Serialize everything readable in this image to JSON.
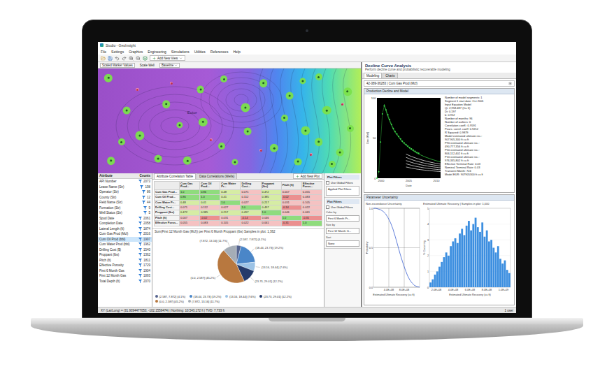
{
  "window": {
    "title": "Studio - GeoInsight"
  },
  "menu": [
    "File",
    "Settings",
    "Graphics",
    "Engineering",
    "Simulations",
    "Utilities",
    "References",
    "Help"
  ],
  "toolbar": {
    "add_view": "Add New View"
  },
  "map": {
    "toolbar": [
      {
        "label": "Scaled Marker Values",
        "kind": "field"
      },
      {
        "label": "Scale Well",
        "kind": "label"
      },
      {
        "label": "Baseline",
        "kind": "select"
      }
    ],
    "label": "Ector",
    "wells": [
      {
        "x": 4,
        "y": 9,
        "level": 0.8,
        "kind": "producer",
        "color": "#7be24c"
      },
      {
        "x": 11,
        "y": 40,
        "level": 0.6,
        "kind": "producer",
        "color": "#7be24c"
      },
      {
        "x": 16,
        "y": 64,
        "level": 0.9,
        "kind": "producer",
        "color": "#7be24c"
      },
      {
        "x": 9,
        "y": 70,
        "level": 0.5,
        "kind": "producer",
        "color": "#7be24c"
      },
      {
        "x": 26,
        "y": 34,
        "level": 0.7,
        "kind": "producer",
        "color": "#7be24c"
      },
      {
        "x": 31,
        "y": 54,
        "level": 0.4,
        "kind": "producer",
        "color": "#7be24c"
      },
      {
        "x": 39,
        "y": 20,
        "level": 0.6,
        "kind": "producer",
        "color": "#7be24c"
      },
      {
        "x": 40,
        "y": 51,
        "level": 0.8,
        "kind": "producer",
        "color": "#7be24c"
      },
      {
        "x": 47,
        "y": 74,
        "level": 0.5,
        "kind": "producer",
        "color": "#7be24c"
      },
      {
        "x": 56,
        "y": 37,
        "level": 0.9,
        "kind": "producer",
        "color": "#7be24c"
      },
      {
        "x": 57,
        "y": 60,
        "level": 0.6,
        "kind": "producer",
        "color": "#7be24c"
      },
      {
        "x": 63,
        "y": 14,
        "level": 0.7,
        "kind": "producer",
        "color": "#7be24c"
      },
      {
        "x": 67,
        "y": 76,
        "level": 0.8,
        "kind": "producer",
        "color": "#7be24c"
      },
      {
        "x": 71,
        "y": 47,
        "level": 0.5,
        "kind": "producer",
        "color": "#7be24c"
      },
      {
        "x": 73,
        "y": 26,
        "level": 0.6,
        "kind": "producer",
        "color": "#7be24c"
      },
      {
        "x": 78,
        "y": 12,
        "level": 0.4,
        "kind": "producer",
        "color": "#7be24c"
      },
      {
        "x": 79,
        "y": 59,
        "level": 0.9,
        "kind": "producer",
        "color": "#7be24c"
      },
      {
        "x": 84,
        "y": 8,
        "level": 0.5,
        "kind": "producer",
        "color": "#7be24c"
      },
      {
        "x": 84,
        "y": 70,
        "level": 0.7,
        "kind": "producer",
        "color": "#7be24c"
      },
      {
        "x": 87,
        "y": 40,
        "level": 0.8,
        "kind": "producer",
        "color": "#7be24c"
      },
      {
        "x": 92,
        "y": 80,
        "level": 0.6,
        "kind": "producer",
        "color": "#7be24c"
      },
      {
        "x": 95,
        "y": 22,
        "level": 0.7,
        "kind": "producer",
        "color": "#7be24c"
      },
      {
        "x": 96,
        "y": 57,
        "level": 0.5,
        "kind": "producer",
        "color": "#7be24c"
      },
      {
        "x": 23,
        "y": 86,
        "level": 0.6,
        "kind": "producer",
        "color": "#7be24c"
      },
      {
        "x": 34,
        "y": 88,
        "level": 0.8,
        "kind": "producer",
        "color": "#7be24c"
      },
      {
        "x": 48,
        "y": 10,
        "level": 0.5,
        "kind": "producer",
        "color": "#7be24c"
      },
      {
        "x": 5,
        "y": 88,
        "level": 0.7,
        "kind": "producer",
        "color": "#7be24c"
      },
      {
        "x": 52,
        "y": 89,
        "level": 0.4,
        "kind": "producer",
        "color": "#7be24c"
      },
      {
        "x": 76,
        "y": 89,
        "level": 0.6,
        "kind": "producer",
        "color": "#7be24c"
      },
      {
        "x": 89,
        "y": 91,
        "level": 0.5,
        "kind": "producer",
        "color": "#7be24c"
      },
      {
        "x": 15,
        "y": 20,
        "level": 0.3,
        "kind": "dry",
        "color": "#f08fb0"
      },
      {
        "x": 28,
        "y": 14,
        "level": 0.3,
        "kind": "dry",
        "color": "#f08fb0"
      },
      {
        "x": 43,
        "y": 68,
        "level": 0.3,
        "kind": "dry",
        "color": "#f08fb0"
      },
      {
        "x": 62,
        "y": 78,
        "level": 0.3,
        "kind": "dry",
        "color": "#f08fb0"
      },
      {
        "x": 81,
        "y": 82,
        "level": 0.3,
        "kind": "dry",
        "color": "#f08fb0"
      },
      {
        "x": 93,
        "y": 34,
        "level": 0.3,
        "kind": "dry",
        "color": "#f08fb0"
      }
    ]
  },
  "attributes": {
    "header": [
      "Attribute",
      "Counts"
    ],
    "items": [
      {
        "name": "API Number",
        "count": "2073",
        "selected": false
      },
      {
        "name": "Lease Name (Str)",
        "count": "198",
        "selected": false
      },
      {
        "name": "Operator (Str)",
        "count": "86",
        "selected": false
      },
      {
        "name": "County (Str)",
        "count": "12",
        "selected": false
      },
      {
        "name": "Field Name (Str)",
        "count": "44",
        "selected": false
      },
      {
        "name": "Formation (Str)",
        "count": "9",
        "selected": false
      },
      {
        "name": "Well Status (Str)",
        "count": "5",
        "selected": false
      },
      {
        "name": "Spud Date",
        "count": "2061",
        "selected": false
      },
      {
        "name": "Completion Date",
        "count": "2058",
        "selected": false
      },
      {
        "name": "Lateral Length (ft)",
        "count": "1874",
        "selected": false
      },
      {
        "name": "Cum Gas Prod (Mcf)",
        "count": "2016",
        "selected": false
      },
      {
        "name": "Cum Oil Prod (bbl)",
        "count": "1997",
        "selected": true
      },
      {
        "name": "Cum Water Prod (bbl)",
        "count": "1962",
        "selected": false
      },
      {
        "name": "Drilling Cost ($)",
        "count": "1540",
        "selected": false
      },
      {
        "name": "Proppant (lbs)",
        "count": "1362",
        "selected": false
      },
      {
        "name": "Pitch (ft)",
        "count": "1811",
        "selected": false
      },
      {
        "name": "Effective Porosity",
        "count": "1729",
        "selected": false
      },
      {
        "name": "First 6 Month Gas",
        "count": "1904",
        "selected": false
      },
      {
        "name": "First 12 Month Gas",
        "count": "1893",
        "selected": false
      },
      {
        "name": "Total Depth (ft)",
        "count": "2070",
        "selected": false
      }
    ]
  },
  "correlation": {
    "tabs": [
      {
        "label": "Attribute Correlation Table",
        "selected": true
      },
      {
        "label": "Data Correlations (Wells)",
        "selected": false
      }
    ],
    "add_plot": "Add New Plot",
    "columns": [
      "Cum Gas Prod...",
      "Cum Oil Prod...",
      "Cum Water Pr...",
      "Drilling Cost...",
      "Proppant (lbs)",
      "Pitch (ft)",
      "Effective Poros..."
    ],
    "rows": [
      {
        "name": "Cum Gas Prod...",
        "values": [
          "1.0",
          "0.86",
          "0.48",
          "0.071",
          "0.472",
          "0.007",
          "0.055"
        ]
      },
      {
        "name": "Cum Oil Prod...",
        "values": [
          "0.86",
          "1.0",
          "0.41",
          "0.112",
          "0.385",
          "-0.02",
          "0.083"
        ]
      },
      {
        "name": "Cum Water Pr...",
        "values": [
          "0.48",
          "0.41",
          "1.0",
          "0.027",
          "0.217",
          "0.031",
          "0.105"
        ]
      },
      {
        "name": "Drilling Cost...",
        "values": [
          "0.071",
          "0.112",
          "0.027",
          "1.0",
          "0.497",
          "-0.14",
          "0.022"
        ]
      },
      {
        "name": "Proppant (lbs)",
        "values": [
          "0.472",
          "0.385",
          "0.217",
          "0.497",
          "1.0",
          "0.046",
          "0.061"
        ]
      },
      {
        "name": "Pitch (ft)",
        "values": [
          "0.007",
          "-0.02",
          "0.031",
          "-0.14",
          "0.046",
          "1.0",
          "-0.31"
        ]
      },
      {
        "name": "Effective Poros...",
        "values": [
          "0.055",
          "0.083",
          "0.105",
          "0.022",
          "0.061",
          "-0.31",
          "1.0"
        ]
      }
    ]
  },
  "pie": {
    "title": "Sum(First 12 Month Gas (Mcf)) per First 6 Month Proppant (lbs)",
    "samples": "Samples in plot: 1,362",
    "slices": [
      {
        "label": "(2.587, 7.872] (4.1%)",
        "value": 4.1,
        "color": "#55648f"
      },
      {
        "label": "(18.44, 23.73] (19.2%)",
        "value": 19.2,
        "color": "#4a86c8"
      },
      {
        "label": "(13.16, 18.44] (7.6%)",
        "value": 7.6,
        "color": "#9cc3e6"
      },
      {
        "label": "(23.73, 29.01] (12.2%)",
        "value": 12.2,
        "color": "#243a6b"
      },
      {
        "label": "(0.0, 2.587] (45.2%)",
        "value": 45.2,
        "color": "#b8783f"
      },
      {
        "label": "(7.872, 13.16] (11.7%)",
        "value": 11.7,
        "color": "#a5adb6"
      }
    ]
  },
  "filters": {
    "top": {
      "title": "Plot Filters",
      "global": {
        "label": "Use Global Filters",
        "checked": false
      },
      "applied": "Applied Plot Filters"
    },
    "bottom": {
      "title": "Plot Filters",
      "global": {
        "label": "Use Global Filters",
        "checked": false
      },
      "fields": [
        {
          "label": "Color by",
          "value": "First 6 Month Pr..."
        },
        {
          "label": "Size by",
          "value": "First 12 Month G..."
        },
        {
          "label": "Sort",
          "value": "None"
        }
      ]
    }
  },
  "dca": {
    "title": "Decline Curve Analysis",
    "subtitle": "Perform decline curve and probabilistic recoverable modeling",
    "tabs": [
      {
        "label": "Modeling",
        "selected": true
      },
      {
        "label": "Charts",
        "selected": false
      }
    ],
    "well": "42-389-36283 | Cum Gas Prod (Mcf)",
    "chart": {
      "title": "Production Decline and Model",
      "x_ticks": [
        "2000",
        "2005",
        "2010"
      ],
      "y_ticks": [
        "0",
        "50",
        "100"
      ],
      "x_label": "Date",
      "y_label": "Gas (Mcf)",
      "series": [
        {
          "kind": "points",
          "start": 0,
          "color": "#3ddc4a",
          "values": [
            0,
            8,
            45,
            80,
            90,
            85,
            79,
            73,
            67,
            62,
            58,
            55,
            52,
            49,
            46,
            44,
            42,
            40,
            38,
            36.5,
            35,
            33.5,
            32,
            31
          ]
        },
        {
          "kind": "line",
          "start": 4,
          "color": "#3ddc4a",
          "values": [
            92,
            84,
            77,
            71,
            66,
            61,
            57,
            54,
            51,
            48,
            45,
            43,
            41,
            39,
            37,
            35.5,
            34,
            32.5,
            31,
            30,
            29,
            28,
            27,
            26,
            25.2,
            24.4,
            23.6,
            22.9,
            22.2,
            21.5,
            20.9,
            20.3
          ]
        },
        {
          "kind": "line",
          "start": 16,
          "color": "#ffffff",
          "values": [
            30,
            29,
            28,
            27,
            26.2,
            25.4,
            24.6,
            23.9,
            23.2,
            22.5,
            21.9,
            21.3,
            20.7,
            20.2,
            19.7,
            19.2,
            18.7,
            18.3,
            17.9,
            17.5
          ]
        },
        {
          "kind": "line",
          "start": 16,
          "color": "#ffffff",
          "values": [
            26,
            25,
            24.1,
            23.3,
            22.5,
            21.8,
            21.1,
            20.5,
            19.9,
            19.3,
            18.8,
            18.3,
            17.8,
            17.4,
            17,
            16.6,
            16.2,
            15.8,
            15.5,
            15.2
          ]
        },
        {
          "kind": "line",
          "start": 16,
          "color": "#ffffff",
          "values": [
            22,
            21.2,
            20.4,
            19.7,
            19,
            18.4,
            17.8,
            17.3,
            16.8,
            16.3,
            15.9,
            15.5,
            15.1,
            14.7,
            14.4,
            14.1,
            13.8,
            13.5,
            13.2,
            12.9
          ]
        },
        {
          "kind": "line",
          "start": 16,
          "color": "#ffffff",
          "values": [
            18,
            17.3,
            16.7,
            16.1,
            15.5,
            15,
            14.5,
            14.1,
            13.7,
            13.3,
            12.9,
            12.6,
            12.3,
            12,
            11.7,
            11.4,
            11.2,
            10.9,
            10.7,
            10.5
          ]
        },
        {
          "kind": "line",
          "start": 16,
          "color": "#ffffff",
          "values": [
            14,
            13.5,
            13,
            12.5,
            12.1,
            11.7,
            11.3,
            11,
            10.7,
            10.4,
            10.1,
            9.9,
            9.6,
            9.4,
            9.2,
            9,
            8.8,
            8.6,
            8.4,
            8.2
          ]
        }
      ]
    },
    "notes": [
      "Number of model segments: 1",
      "Segment 1 start date: Oct 2001",
      "Input Equation Model",
      "Qi: 2,958.487 (Cu ft)",
      "Di: 0.197",
      "b: 0.952",
      "Number of months: 96",
      "Number of outliers: 0",
      "Correlation coeff.: 0.9591",
      "Pears. correl. coeff: 0.9212",
      "R Squared: 0.9879",
      "Model estimated ultimate rec.:",
      "907,905,300 ft cu ft",
      "P90 estimated ultimate rec.:",
      "490,777,356 ft cu ft",
      "P50 estimated ultimate rec.:",
      "806,112,402 ft cu ft",
      "P10 estimated ultimate rec.:",
      "976,335,802 ft cu ft",
      "Effective Terminal Rate: 0.03",
      "Nominal Terminal Rate: 0.03",
      "Transient Month: 724",
      "Model EUR: 907905300 ft cu ft"
    ]
  },
  "uncertainty": {
    "title": "Parameter Uncertainty",
    "cdf": {
      "title": "Non-exceedance Uncertainty",
      "x_label": "Estimated Ultimate Recovery (cu ft)",
      "y_label": "Probability",
      "x_ticks": [
        "4.0E+08",
        "8.0E+08"
      ],
      "y_ticks": [
        "0.0",
        "0.5",
        "1.0"
      ],
      "values": [
        1,
        1,
        0.99,
        0.98,
        0.96,
        0.93,
        0.88,
        0.82,
        0.74,
        0.64,
        0.53,
        0.42,
        0.32,
        0.23,
        0.15,
        0.09,
        0.05,
        0.02,
        0.01,
        0
      ]
    },
    "histogram": {
      "title": "Estimated Ultimate Recovery | Samples in plot: 1,000",
      "x_label": "Estimated Ultimate Recovery (cu ft)",
      "y_label": "% Occurring",
      "x_ticks": [
        "2.0E+08",
        "4.0E+08",
        "6.0E+08",
        "8.0E+08",
        "1.0E+09"
      ],
      "y_ticks": [
        "0",
        "1",
        "2",
        "3",
        "4",
        "5"
      ],
      "values": [
        0.3,
        0.5,
        0.8,
        1.0,
        1.3,
        1.6,
        1.9,
        2.2,
        2.0,
        2.6,
        2.9,
        3.1,
        2.8,
        3.4,
        3.7,
        3.3,
        3.9,
        4.2,
        3.6,
        4.0,
        4.4,
        3.8,
        3.5,
        4.1,
        3.2,
        3.6,
        2.9,
        3.0,
        2.5,
        2.2,
        2.6,
        1.8,
        1.5,
        1.7,
        1.1,
        0.9
      ]
    }
  },
  "status_bar": {
    "text": "XY (Lat/Long) = (31.9394477053, -102.1559474) | Northing: 10,543,172 ft | TVD: 7,733 ft",
    "users": "1 user"
  }
}
